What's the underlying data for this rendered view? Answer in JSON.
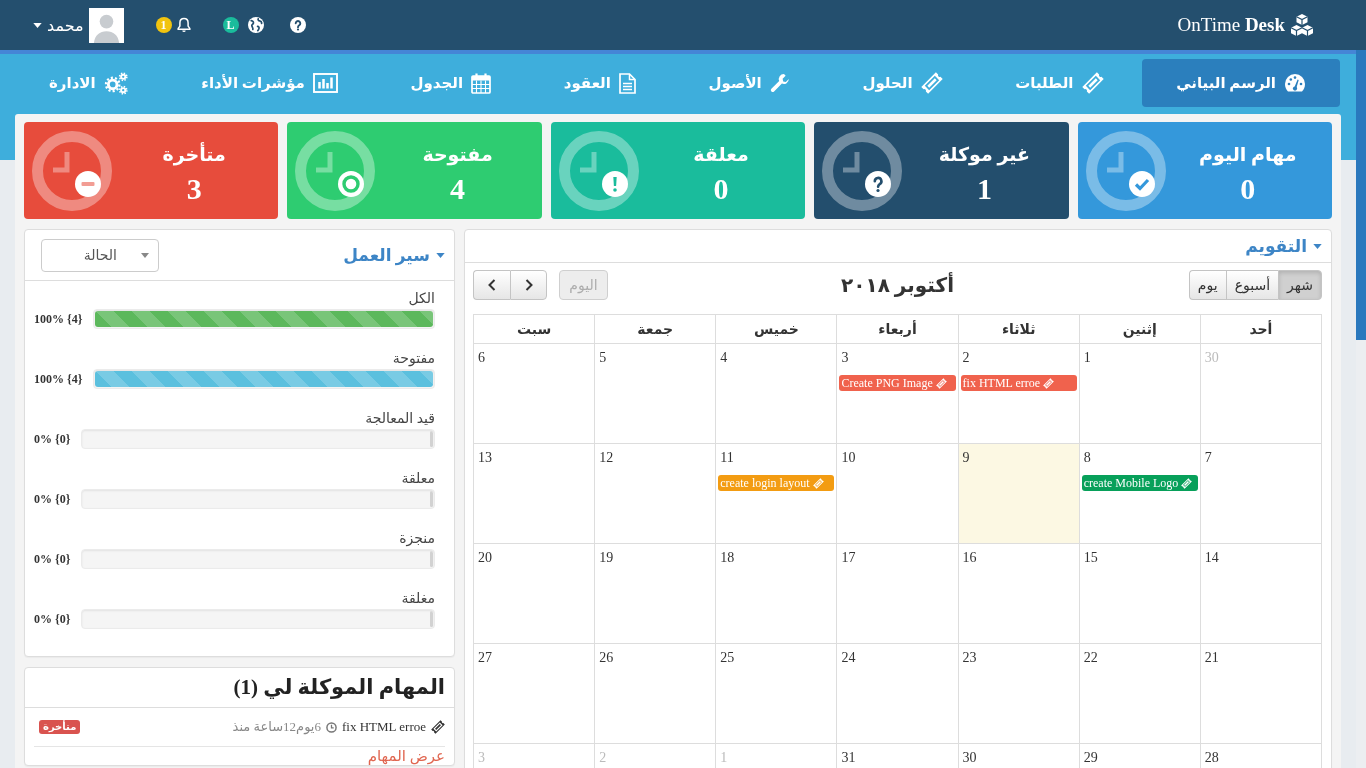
{
  "topbar": {
    "brand": "OnTime **Desk**",
    "language_badge": "L",
    "notification_count": "1",
    "user_name": "محمد"
  },
  "nav": [
    {
      "label": "الرسم البياني",
      "kind": "dashboard",
      "selected": true
    },
    {
      "label": "الطلبات",
      "kind": "ticket",
      "selected": false
    },
    {
      "label": "الحلول",
      "kind": "ticket",
      "selected": false
    },
    {
      "label": "الأصول",
      "kind": "wrench",
      "selected": false
    },
    {
      "label": "العقود",
      "kind": "document",
      "selected": false
    },
    {
      "label": "الجدول",
      "kind": "calendar",
      "selected": false
    },
    {
      "label": "مؤشرات الأداء",
      "kind": "chart",
      "selected": false
    },
    {
      "label": "الادارة",
      "kind": "gears",
      "selected": false
    }
  ],
  "stats": [
    {
      "title": "مهام اليوم",
      "value": "0",
      "kind": "check",
      "color": "#3498db"
    },
    {
      "title": "غير موكلة",
      "value": "1",
      "kind": "question",
      "color": "#234e6d"
    },
    {
      "title": "معلقة",
      "value": "0",
      "kind": "exclamation",
      "color": "#1abc9c"
    },
    {
      "title": "مفتوحة",
      "value": "4",
      "kind": "dot",
      "color": "#2ecc71"
    },
    {
      "title": "متأخرة",
      "value": "3",
      "kind": "minus",
      "color": "#e74c3c"
    }
  ],
  "calendar": {
    "title": "التقويم",
    "views": [
      {
        "label": "شهر",
        "selected": true
      },
      {
        "label": "أسبوع",
        "selected": false
      },
      {
        "label": "يوم",
        "selected": false
      }
    ],
    "heading": "أكتوبر ٢٠١٨",
    "today_button": {
      "label": "اليوم",
      "disabled": true
    },
    "weekdays": [
      "أحد",
      "إثنين",
      "ثلاثاء",
      "أربعاء",
      "خميس",
      "جمعة",
      "سبت"
    ],
    "weeks": [
      [
        {
          "day": "30",
          "other_month": true,
          "today": false
        },
        {
          "day": "1",
          "other_month": false,
          "today": false
        },
        {
          "day": "2",
          "other_month": false,
          "today": false,
          "events": [
            {
              "title": "fix HTML erroe",
              "color": "#f0624d"
            }
          ]
        },
        {
          "day": "3",
          "other_month": false,
          "today": false,
          "events": [
            {
              "title": "Create PNG Image",
              "color": "#f0624d"
            }
          ]
        },
        {
          "day": "4",
          "other_month": false,
          "today": false
        },
        {
          "day": "5",
          "other_month": false,
          "today": false
        },
        {
          "day": "6",
          "other_month": false,
          "today": false
        }
      ],
      [
        {
          "day": "7",
          "other_month": false,
          "today": false
        },
        {
          "day": "8",
          "other_month": false,
          "today": false,
          "events": [
            {
              "title": "create Mobile Logo",
              "color": "#07a05a"
            }
          ]
        },
        {
          "day": "9",
          "other_month": false,
          "today": true
        },
        {
          "day": "10",
          "other_month": false,
          "today": false
        },
        {
          "day": "11",
          "other_month": false,
          "today": false,
          "events": [
            {
              "title": "create login layout",
              "color": "#f39c12"
            }
          ]
        },
        {
          "day": "12",
          "other_month": false,
          "today": false
        },
        {
          "day": "13",
          "other_month": false,
          "today": false
        }
      ],
      [
        {
          "day": "14",
          "other_month": false,
          "today": false
        },
        {
          "day": "15",
          "other_month": false,
          "today": false
        },
        {
          "day": "16",
          "other_month": false,
          "today": false
        },
        {
          "day": "17",
          "other_month": false,
          "today": false
        },
        {
          "day": "18",
          "other_month": false,
          "today": false
        },
        {
          "day": "19",
          "other_month": false,
          "today": false
        },
        {
          "day": "20",
          "other_month": false,
          "today": false
        }
      ],
      [
        {
          "day": "21",
          "other_month": false,
          "today": false
        },
        {
          "day": "22",
          "other_month": false,
          "today": false
        },
        {
          "day": "23",
          "other_month": false,
          "today": false
        },
        {
          "day": "24",
          "other_month": false,
          "today": false
        },
        {
          "day": "25",
          "other_month": false,
          "today": false
        },
        {
          "day": "26",
          "other_month": false,
          "today": false
        },
        {
          "day": "27",
          "other_month": false,
          "today": false
        }
      ],
      [
        {
          "day": "28",
          "other_month": false,
          "today": false
        },
        {
          "day": "29",
          "other_month": false,
          "today": false
        },
        {
          "day": "30",
          "other_month": false,
          "today": false
        },
        {
          "day": "31",
          "other_month": false,
          "today": false
        },
        {
          "day": "1",
          "other_month": true,
          "today": false
        },
        {
          "day": "2",
          "other_month": true,
          "today": false
        },
        {
          "day": "3",
          "other_month": true,
          "today": false
        }
      ]
    ]
  },
  "workflow": {
    "title": "سير العمل",
    "status_select": {
      "value": "الحالة"
    },
    "bars": [
      {
        "label": "الكل",
        "reading": "100% {4}",
        "level": 1,
        "color": "#5cb85c"
      },
      {
        "label": "مفتوحة",
        "reading": "100% {4}",
        "level": 1,
        "color": "#5bc0de"
      },
      {
        "label": "قيد المعالجة",
        "reading": "0% {0}",
        "level": 0
      },
      {
        "label": "معلقة",
        "reading": "0% {0}",
        "level": 0
      },
      {
        "label": "منجزة",
        "reading": "0% {0}",
        "level": 0
      },
      {
        "label": "مغلقة",
        "reading": "0% {0}",
        "level": 0
      }
    ]
  },
  "my_tasks": {
    "title": "المهام الموكلة لي (1)",
    "tasks": [
      {
        "title": "fix HTML erroe",
        "age": "6يوم12ساعة منذ",
        "badge": "متأخرة"
      }
    ],
    "link": "عرض المهام"
  }
}
